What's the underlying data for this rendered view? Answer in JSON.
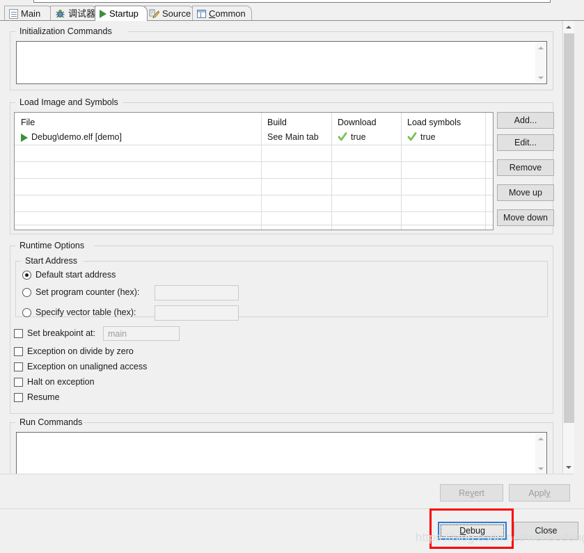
{
  "window": {
    "tabs": [
      {
        "id": "main",
        "label": "Main",
        "icon": "document-icon",
        "selected": false,
        "underline_char": ""
      },
      {
        "id": "debugger",
        "label": "调试器",
        "icon": "bug-icon",
        "selected": false,
        "underline_char": ""
      },
      {
        "id": "startup",
        "label": "Startup",
        "icon": "play-icon",
        "selected": true,
        "underline_char": ""
      },
      {
        "id": "source",
        "label": "Source",
        "icon": "source-edit-icon",
        "selected": false,
        "underline_char": ""
      },
      {
        "id": "common",
        "label": "Common",
        "icon": "table-icon",
        "selected": false,
        "underline_char": "C"
      }
    ]
  },
  "init_commands": {
    "group_label": "Initialization Commands",
    "value": "",
    "placeholder": ""
  },
  "load_image": {
    "group_label": "Load Image and Symbols",
    "columns": [
      "File",
      "Build",
      "Download",
      "Load symbols"
    ],
    "rows": [
      {
        "file": "Debug\\demo.elf [demo]",
        "file_icon": "play-icon",
        "build": "See Main tab",
        "download": "true",
        "download_icon": "green-check-icon",
        "load_symbols": "true",
        "load_symbols_icon": "green-check-icon"
      }
    ],
    "buttons": [
      {
        "id": "add",
        "label": "Add...",
        "enabled": true
      },
      {
        "id": "edit",
        "label": "Edit...",
        "enabled": true
      },
      {
        "id": "remove",
        "label": "Remove",
        "enabled": true
      },
      {
        "id": "move-up",
        "label": "Move up",
        "enabled": true
      },
      {
        "id": "move-down",
        "label": "Move down",
        "enabled": true
      }
    ]
  },
  "runtime_options": {
    "group_label": "Runtime Options",
    "start_address": {
      "group_label": "Start Address",
      "radios": [
        {
          "id": "default-start-address",
          "label": "Default start address",
          "selected": true,
          "has_input": false,
          "input_value": ""
        },
        {
          "id": "set-program-counter",
          "label": "Set program counter (hex):",
          "selected": false,
          "has_input": true,
          "input_value": ""
        },
        {
          "id": "specify-vector-table",
          "label": "Specify vector table (hex):",
          "selected": false,
          "has_input": true,
          "input_value": ""
        }
      ]
    },
    "checkboxes": [
      {
        "id": "set-breakpoint-at",
        "label": "Set breakpoint at:",
        "checked": false,
        "has_input": true,
        "input_value": "",
        "input_placeholder": "main"
      },
      {
        "id": "exception-on-divide-by-zero",
        "label": "Exception on divide by zero",
        "checked": false,
        "has_input": false,
        "input_value": "",
        "input_placeholder": ""
      },
      {
        "id": "exception-on-unaligned",
        "label": "Exception on unaligned access",
        "checked": false,
        "has_input": false,
        "input_value": "",
        "input_placeholder": ""
      },
      {
        "id": "halt-on-exception",
        "label": "Halt on exception",
        "checked": false,
        "has_input": false,
        "input_value": "",
        "input_placeholder": ""
      },
      {
        "id": "resume",
        "label": "Resume",
        "checked": false,
        "has_input": false,
        "input_value": "",
        "input_placeholder": ""
      }
    ]
  },
  "run_commands": {
    "group_label": "Run Commands",
    "value": "",
    "placeholder": ""
  },
  "footer": {
    "revert_label": "Revert",
    "revert_enabled": false,
    "apply_label": "Apply",
    "apply_enabled": false,
    "debug_label": "Debug",
    "debug_underline_char": "D",
    "debug_focused": true,
    "close_label": "Close",
    "highlight_color": "#fb0000"
  },
  "watermark": {
    "text": "https://blog.csdn.net/wenbodong"
  },
  "colors": {
    "dialog_bg": "#f0f0f0",
    "field_bg": "#ffffff",
    "button_bg": "#e1e1e1",
    "focus_blue": "#2a7fd4",
    "green_check": "#5aab39",
    "highlight_red": "#fb0000"
  }
}
